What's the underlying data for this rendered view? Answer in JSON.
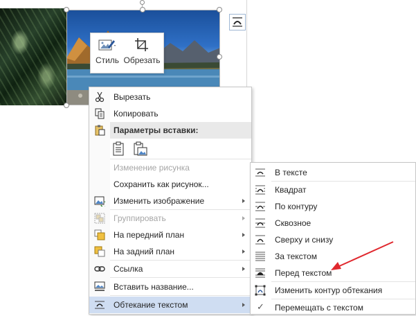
{
  "mini_toolbar": {
    "style_label": "Стиль",
    "crop_label": "Обрезать"
  },
  "context_menu": {
    "items": [
      {
        "label": "Вырезать",
        "icon": "scissors-icon"
      },
      {
        "label": "Копировать",
        "icon": "copy-icon"
      },
      {
        "label": "Параметры вставки:",
        "icon": "paste-icon"
      },
      {
        "label": "Изменение рисунка",
        "disabled": true
      },
      {
        "label": "Сохранить как рисунок..."
      },
      {
        "label": "Изменить изображение",
        "icon": "change-picture-icon"
      },
      {
        "label": "Группировать",
        "icon": "group-icon",
        "disabled": true
      },
      {
        "label": "На передний план",
        "icon": "bring-forward-icon"
      },
      {
        "label": "На задний план",
        "icon": "send-backward-icon"
      },
      {
        "label": "Ссылка",
        "icon": "link-icon"
      },
      {
        "label": "Вставить название...",
        "icon": "insert-caption-icon"
      },
      {
        "label": "Обтекание текстом",
        "icon": "wrap-text-icon",
        "highlighted": true
      }
    ]
  },
  "wrap_submenu": {
    "items": [
      {
        "label": "В тексте",
        "icon": "wrap-inline-icon"
      },
      {
        "label": "Квадрат",
        "icon": "wrap-square-icon"
      },
      {
        "label": "По контуру",
        "icon": "wrap-tight-icon"
      },
      {
        "label": "Сквозное",
        "icon": "wrap-through-icon"
      },
      {
        "label": "Сверху и снизу",
        "icon": "wrap-top-bottom-icon"
      },
      {
        "label": "За текстом",
        "icon": "wrap-behind-icon"
      },
      {
        "label": "Перед текстом",
        "icon": "wrap-front-icon"
      },
      {
        "label": "Изменить контур обтекания",
        "icon": "edit-wrap-points-icon"
      },
      {
        "label": "Перемещать с текстом",
        "checked": true
      }
    ]
  },
  "colors": {
    "highlight": "#cfddf2",
    "annotation_arrow": "#e0282e",
    "accent_blue": "#2b579a"
  }
}
